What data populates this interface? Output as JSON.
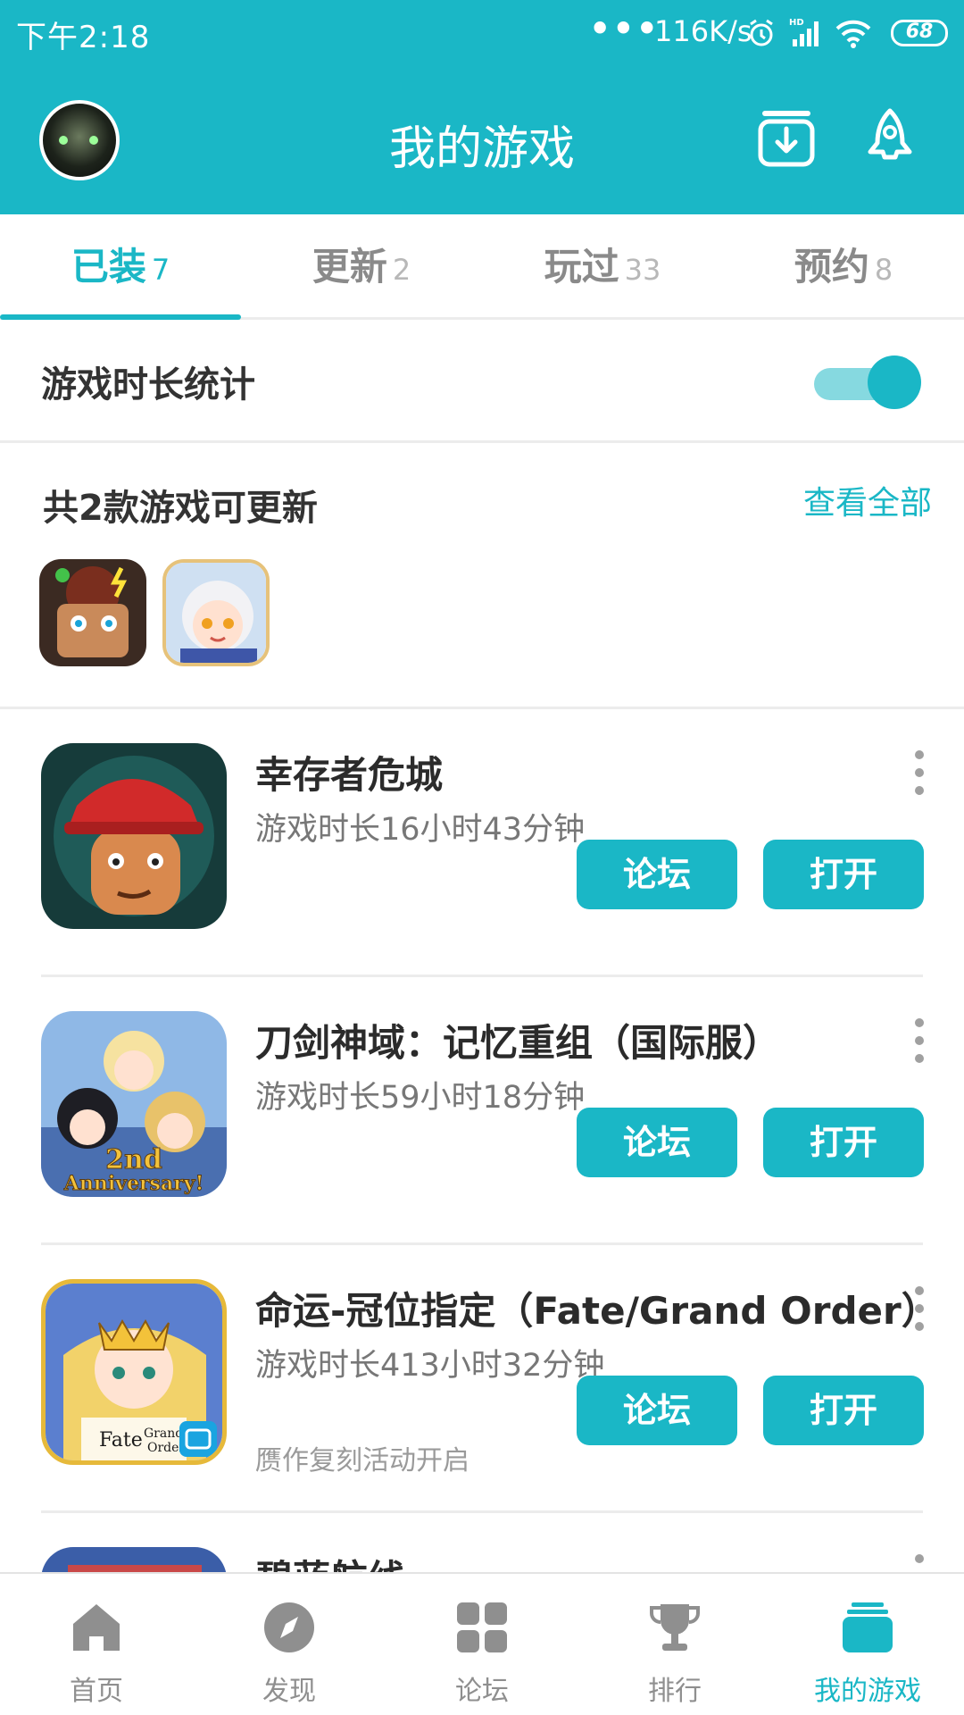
{
  "status_bar": {
    "time": "下午2:18",
    "dots": "•••",
    "net_speed": "116K/s",
    "battery": "68"
  },
  "header": {
    "title": "我的游戏",
    "icons": [
      "avatar",
      "download-box-icon",
      "rocket-icon"
    ]
  },
  "tabs": [
    {
      "label": "已装",
      "count": "7",
      "active": true
    },
    {
      "label": "更新",
      "count": "2",
      "active": false
    },
    {
      "label": "玩过",
      "count": "33",
      "active": false
    },
    {
      "label": "预约",
      "count": "8",
      "active": false
    }
  ],
  "playtime_stats": {
    "label": "游戏时长统计",
    "enabled": true
  },
  "updates": {
    "title": "共2款游戏可更新",
    "view_all": "查看全部",
    "icons": [
      "game-icon-update-1",
      "game-icon-update-2"
    ]
  },
  "games": [
    {
      "name": "幸存者危城",
      "playtime": "游戏时长16小时43分钟",
      "note": "",
      "forum": "论坛",
      "open": "打开"
    },
    {
      "name": "刀剑神域：记忆重组（国际服）",
      "playtime": "游戏时长59小时18分钟",
      "note": "",
      "forum": "论坛",
      "open": "打开"
    },
    {
      "name": "命运-冠位指定（Fate/Grand Order）",
      "playtime": "游戏时长413小时32分钟",
      "note": "赝作复刻活动开启",
      "forum": "论坛",
      "open": "打开"
    },
    {
      "name": "碧蓝航线",
      "playtime": "",
      "note": "",
      "forum": "",
      "open": ""
    }
  ],
  "bottom_nav": [
    {
      "label": "首页",
      "icon": "home-icon",
      "active": false
    },
    {
      "label": "发现",
      "icon": "compass-icon",
      "active": false
    },
    {
      "label": "论坛",
      "icon": "grid-icon",
      "active": false
    },
    {
      "label": "排行",
      "icon": "trophy-icon",
      "active": false
    },
    {
      "label": "我的游戏",
      "icon": "my-games-icon",
      "active": true
    }
  ],
  "colors": {
    "accent": "#1ab7c6",
    "toggle_track": "#86d9e0",
    "divider": "#ececec",
    "text_primary": "#2b2b2b",
    "text_secondary": "#777777"
  }
}
